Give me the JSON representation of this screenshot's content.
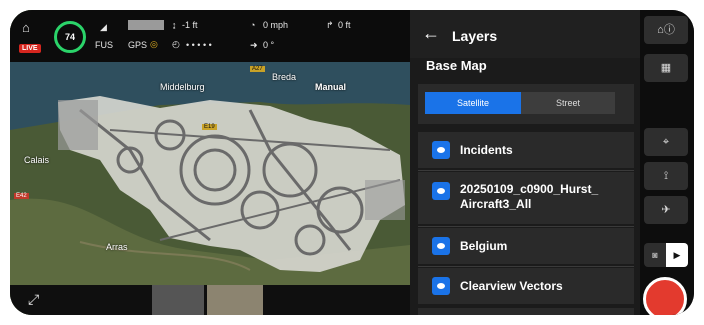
{
  "status": {
    "live_label": "LIVE",
    "battery": "74",
    "signal_label": "FUS",
    "gps_label": "GPS",
    "altitude": "-1 ft",
    "speed": "0 mph",
    "distance": "0 ft",
    "heading": "0 °",
    "gps_dots": "• • • • •"
  },
  "map": {
    "labels": [
      "Middelburg",
      "Breda",
      "Manual",
      "Calais",
      "Arras"
    ],
    "road_badges": [
      "A27",
      "E19",
      "E42"
    ]
  },
  "layers": {
    "title": "Layers",
    "base_map_title": "Base Map",
    "base_map_options": [
      "Satellite",
      "Street"
    ],
    "selected_base_map": "Satellite",
    "items": [
      {
        "label": "Incidents",
        "visible": true
      },
      {
        "label": "20250109_c0900_Hurst_\nAircraft3_All",
        "visible": true
      },
      {
        "label": "Belgium",
        "visible": true
      },
      {
        "label": "Clearview Vectors",
        "visible": true
      }
    ]
  },
  "colors": {
    "accent": "#1a73e8",
    "live": "#d6261f",
    "battery_ring": "#2bd46a",
    "record": "#e33a2e"
  }
}
